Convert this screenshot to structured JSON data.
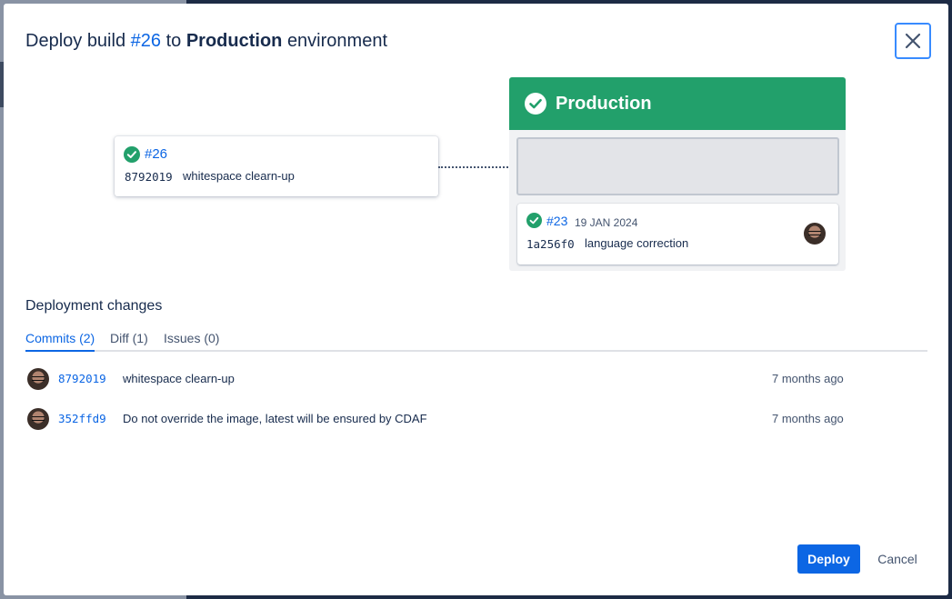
{
  "dialog": {
    "title_prefix": "Deploy build",
    "build_ref": "#26",
    "title_mid": "to",
    "environment": "Production",
    "title_suffix": "environment"
  },
  "build_card": {
    "number": "#26",
    "commit_hash": "8792019",
    "commit_message": "whitespace clearn-up"
  },
  "environment_panel": {
    "name": "Production",
    "header_color": "#22a06b",
    "current_deployment": {
      "number": "#23",
      "date": "19 JAN 2024",
      "commit_hash": "1a256f0",
      "commit_message": "language correction"
    }
  },
  "changes": {
    "title": "Deployment changes",
    "tabs": [
      {
        "label": "Commits (2)",
        "active": true
      },
      {
        "label": "Diff (1)",
        "active": false
      },
      {
        "label": "Issues (0)",
        "active": false
      }
    ],
    "commits": [
      {
        "hash": "8792019",
        "message": "whitespace clearn-up",
        "time": "7 months ago"
      },
      {
        "hash": "352ffd9",
        "message": "Do not override the image, latest will be ensured by CDAF",
        "time": "7 months ago"
      }
    ]
  },
  "actions": {
    "deploy_label": "Deploy",
    "cancel_label": "Cancel"
  },
  "icons": {
    "close": "close-icon",
    "check": "check-circle-icon",
    "avatar": "user-avatar"
  },
  "colors": {
    "primary": "#0c66e4",
    "success": "#22a06b",
    "text": "#172b4d"
  }
}
